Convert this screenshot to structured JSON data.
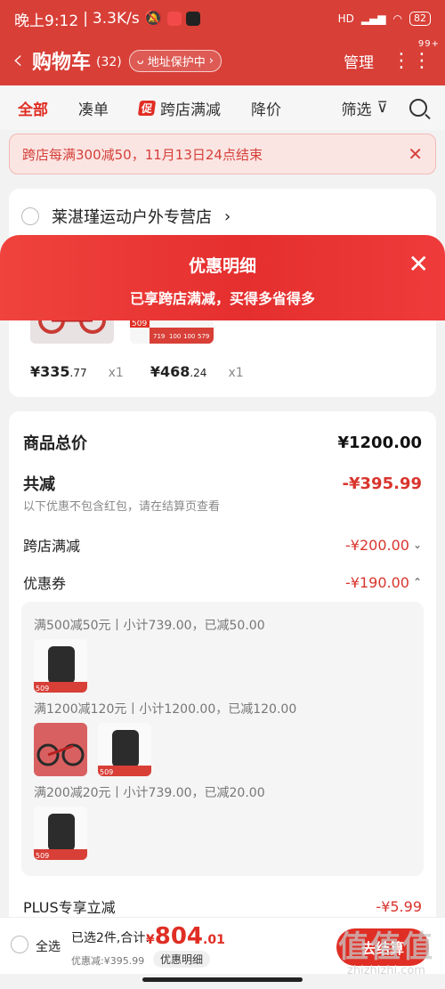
{
  "status": {
    "time": "晚上9:12",
    "speed": "3.3K/s",
    "signal": "HD",
    "battery": "82"
  },
  "header": {
    "title": "购物车",
    "count": "(32)",
    "address": "地址保护中",
    "manage": "管理",
    "more_badge": "99+"
  },
  "tabs": [
    {
      "label": "全部",
      "active": true
    },
    {
      "label": "凑单"
    },
    {
      "label": "跨店满减",
      "badge": "促"
    },
    {
      "label": "降价"
    }
  ],
  "filter_label": "筛选",
  "notice": {
    "text": "跨店每满300减50，11月13日24点结束"
  },
  "shop": {
    "name": "莱湛瑾运动户外专营店",
    "items": [
      {
        "price_int": "¥335",
        "price_dec": ".77",
        "qty": "x1"
      },
      {
        "price_int": "¥468",
        "price_dec": ".24",
        "qty": "x1"
      }
    ],
    "thumb_tag": "509",
    "thumb_prices": [
      "719",
      "100",
      "100",
      "579"
    ]
  },
  "sheet": {
    "title": "优惠明细",
    "subtitle": "已享跨店满减，买得多省得多"
  },
  "detail": {
    "total_label": "商品总价",
    "total_value": "¥1200.00",
    "reduce_label": "共减",
    "reduce_value": "-¥395.99",
    "note": "以下优惠不包含红包，请在结算页查看",
    "cross_label": "跨店满减",
    "cross_value": "-¥200.00",
    "coupon_label": "优惠券",
    "coupon_value": "-¥190.00",
    "coupons": [
      {
        "title": "满500减50元丨小计739.00，已减50.00"
      },
      {
        "title": "满1200减120元丨小计1200.00，已减120.00"
      },
      {
        "title": "满200减20元丨小计739.00，已减20.00"
      }
    ],
    "plus_label": "PLUS专享立减",
    "plus_value": "-¥5.99"
  },
  "bottom": {
    "select_all": "全选",
    "selected": "已选2件,合计:",
    "currency": "¥",
    "total_int": "804",
    "total_dec": ".01",
    "discount": "优惠减:¥395.99",
    "detail_btn": "优惠明细",
    "checkout": "去结算"
  },
  "watermark": {
    "big": "值值值",
    "small": "zhizhizhi.com"
  },
  "colors": {
    "brand_red": "#d83f37",
    "accent_red": "#e02e24"
  }
}
